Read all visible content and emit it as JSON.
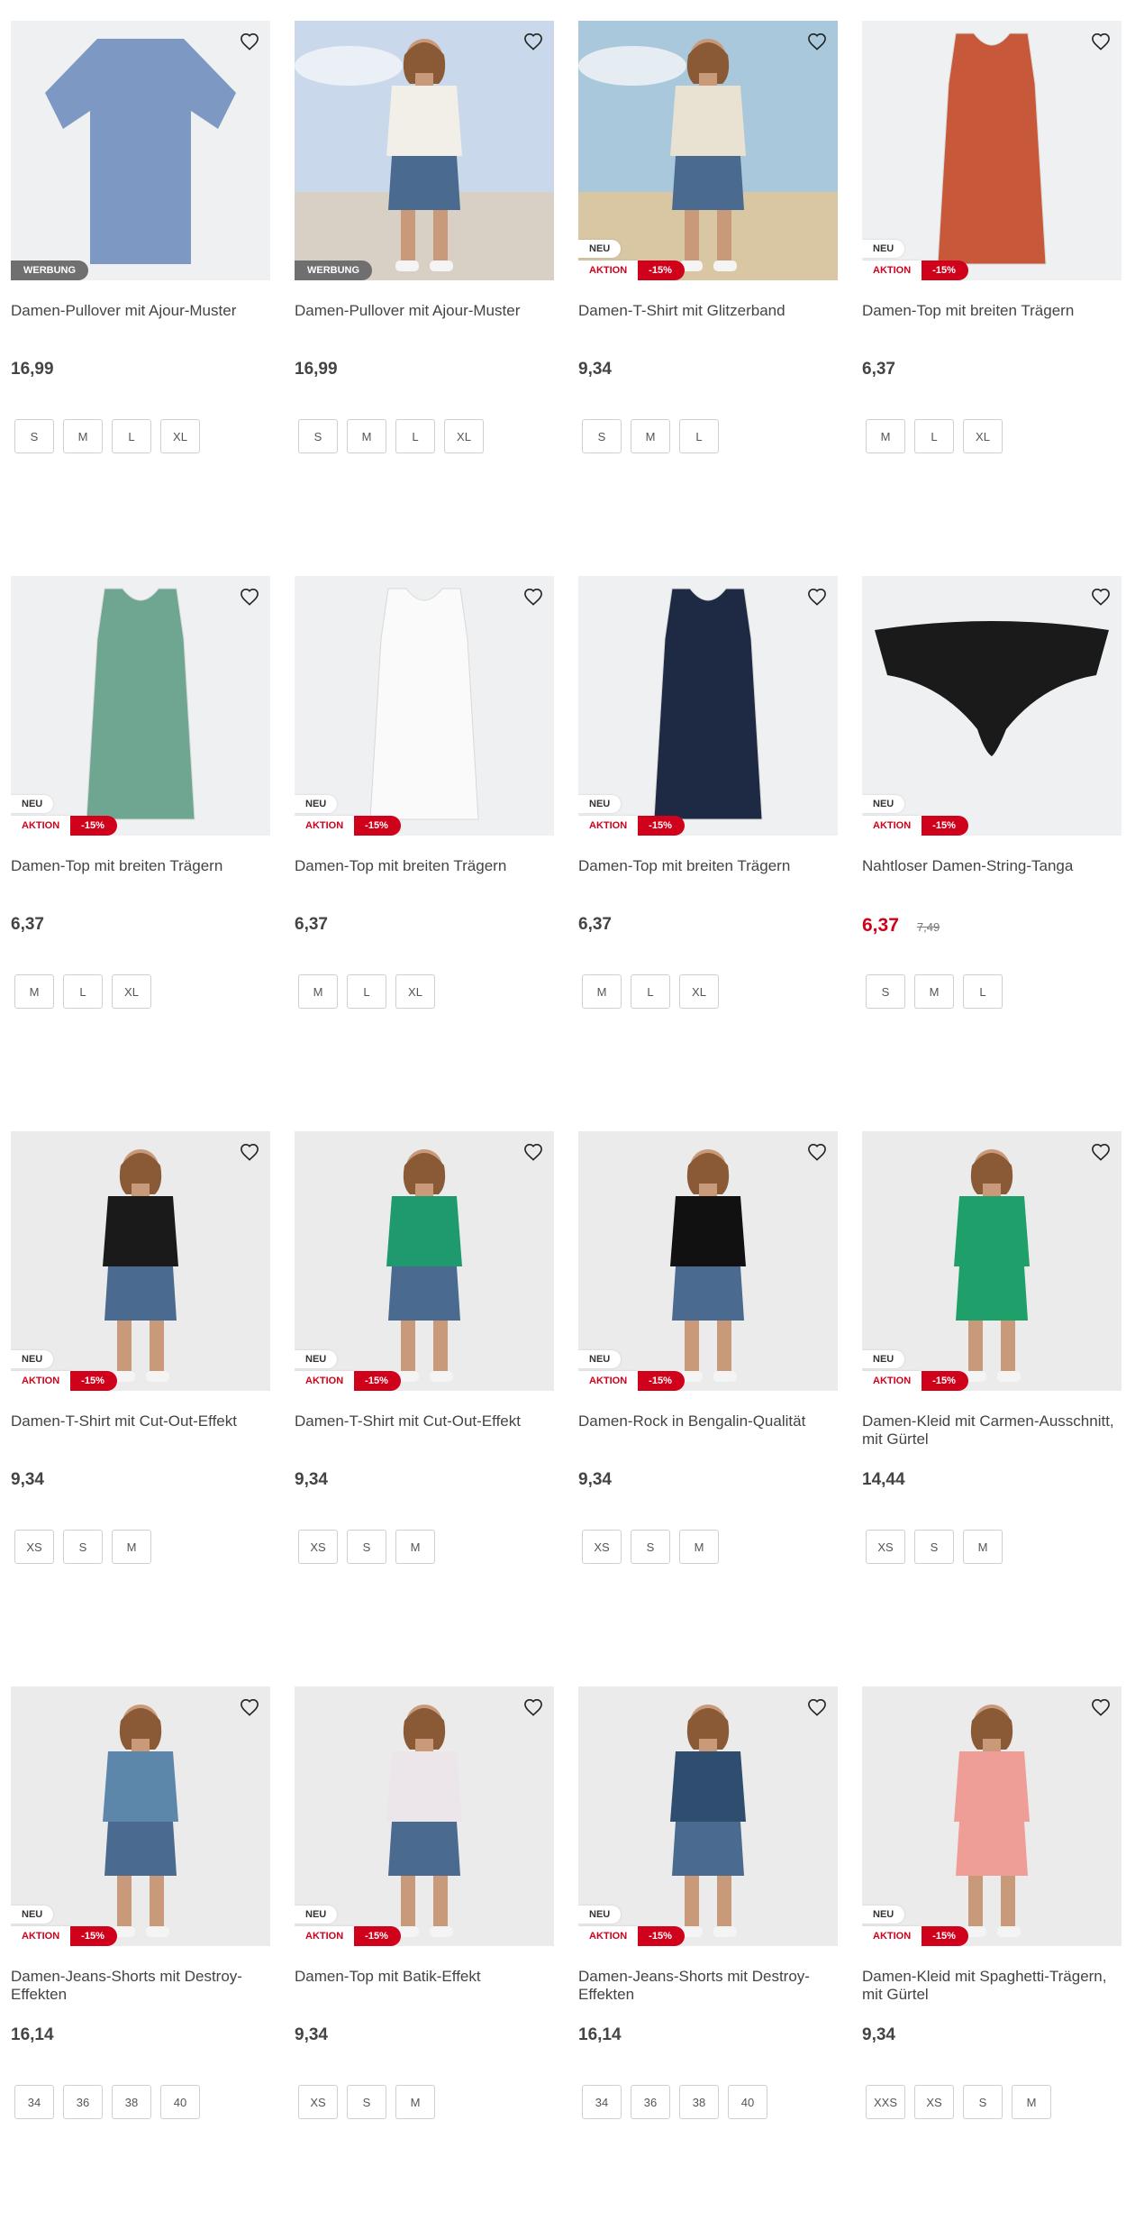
{
  "colors": {
    "accent": "#d0021b",
    "badge_grey": "#6f6f6f"
  },
  "products": [
    {
      "title": "Damen-Pullover mit Ajour-Muster",
      "price": "16,99",
      "old_price": "",
      "sale": false,
      "badges": [
        "WERBUNG"
      ],
      "sizes": [
        "S",
        "M",
        "L",
        "XL"
      ],
      "image": "blue-knit-pullover",
      "bg": "#eef0f1",
      "color": "#7d98c3"
    },
    {
      "title": "Damen-Pullover mit Ajour-Muster",
      "price": "16,99",
      "old_price": "",
      "sale": false,
      "badges": [
        "WERBUNG"
      ],
      "sizes": [
        "S",
        "M",
        "L",
        "XL"
      ],
      "image": "white-pullover-model-sky",
      "bg": "#c9d8ea",
      "color": "#f2efe8"
    },
    {
      "title": "Damen-T-Shirt mit Glitzerband",
      "price": "9,34",
      "old_price": "",
      "sale": false,
      "badges": [
        "NEU",
        "AKTION",
        "-15%"
      ],
      "sizes": [
        "S",
        "M",
        "L"
      ],
      "image": "beige-tshirt-model-beach",
      "bg": "#a9c8dc",
      "color": "#e9e1d2"
    },
    {
      "title": "Damen-Top mit breiten Trägern",
      "price": "6,37",
      "old_price": "",
      "sale": false,
      "badges": [
        "NEU",
        "AKTION",
        "-15%"
      ],
      "sizes": [
        "M",
        "L",
        "XL"
      ],
      "image": "orange-tank-top",
      "bg": "#eef0f1",
      "color": "#c8583a"
    },
    {
      "title": "Damen-Top mit breiten Trägern",
      "price": "6,37",
      "old_price": "",
      "sale": false,
      "badges": [
        "NEU",
        "AKTION",
        "-15%"
      ],
      "sizes": [
        "M",
        "L",
        "XL"
      ],
      "image": "green-tank-top",
      "bg": "#eef0f1",
      "color": "#6fa692"
    },
    {
      "title": "Damen-Top mit breiten Trägern",
      "price": "6,37",
      "old_price": "",
      "sale": false,
      "badges": [
        "NEU",
        "AKTION",
        "-15%"
      ],
      "sizes": [
        "M",
        "L",
        "XL"
      ],
      "image": "white-tank-top",
      "bg": "#eef0f1",
      "color": "#fafafa"
    },
    {
      "title": "Damen-Top mit breiten Trägern",
      "price": "6,37",
      "old_price": "",
      "sale": false,
      "badges": [
        "NEU",
        "AKTION",
        "-15%"
      ],
      "sizes": [
        "M",
        "L",
        "XL"
      ],
      "image": "navy-tank-top",
      "bg": "#eef0f1",
      "color": "#1e2a44"
    },
    {
      "title": "Nahtloser Damen-String-Tanga",
      "price": "6,37",
      "old_price": "7,49",
      "sale": true,
      "badges": [
        "NEU",
        "AKTION",
        "-15%"
      ],
      "sizes": [
        "S",
        "M",
        "L"
      ],
      "image": "black-thong",
      "bg": "#eef0f1",
      "color": "#1a1a1a"
    },
    {
      "title": "Damen-T-Shirt mit Cut-Out-Effekt",
      "price": "9,34",
      "old_price": "",
      "sale": false,
      "badges": [
        "NEU",
        "AKTION",
        "-15%"
      ],
      "sizes": [
        "XS",
        "S",
        "M"
      ],
      "image": "black-cutout-tshirt-model",
      "bg": "#ebebeb",
      "color": "#1a1a1a"
    },
    {
      "title": "Damen-T-Shirt mit Cut-Out-Effekt",
      "price": "9,34",
      "old_price": "",
      "sale": false,
      "badges": [
        "NEU",
        "AKTION",
        "-15%"
      ],
      "sizes": [
        "XS",
        "S",
        "M"
      ],
      "image": "green-cutout-tshirt-model",
      "bg": "#ebebeb",
      "color": "#1e9a6e"
    },
    {
      "title": "Damen-Rock in Bengalin-Qualität",
      "price": "9,34",
      "old_price": "",
      "sale": false,
      "badges": [
        "NEU",
        "AKTION",
        "-15%"
      ],
      "sizes": [
        "XS",
        "S",
        "M"
      ],
      "image": "black-skirt-model",
      "bg": "#ebebeb",
      "color": "#111111"
    },
    {
      "title": "Damen-Kleid mit Carmen-Ausschnitt, mit Gürtel",
      "price": "14,44",
      "old_price": "",
      "sale": false,
      "badges": [
        "NEU",
        "AKTION",
        "-15%"
      ],
      "sizes": [
        "XS",
        "S",
        "M"
      ],
      "image": "green-dress-model",
      "bg": "#ebebeb",
      "color": "#1fa06a"
    },
    {
      "title": "Damen-Jeans-Shorts mit Destroy-Effekten",
      "price": "16,14",
      "old_price": "",
      "sale": false,
      "badges": [
        "NEU",
        "AKTION",
        "-15%"
      ],
      "sizes": [
        "34",
        "36",
        "38",
        "40"
      ],
      "image": "striped-top-jeans-shorts-model",
      "bg": "#ebebeb",
      "color": "#5d86ab"
    },
    {
      "title": "Damen-Top mit Batik-Effekt",
      "price": "9,34",
      "old_price": "",
      "sale": false,
      "badges": [
        "NEU",
        "AKTION",
        "-15%"
      ],
      "sizes": [
        "XS",
        "S",
        "M"
      ],
      "image": "batik-top-model",
      "bg": "#ebebeb",
      "color": "#ece6ea"
    },
    {
      "title": "Damen-Jeans-Shorts mit Destroy-Effekten",
      "price": "16,14",
      "old_price": "",
      "sale": false,
      "badges": [
        "NEU",
        "AKTION",
        "-15%"
      ],
      "sizes": [
        "34",
        "36",
        "38",
        "40"
      ],
      "image": "pink-blouse-jeans-shorts-model",
      "bg": "#ebebeb",
      "color": "#2f4d6e"
    },
    {
      "title": "Damen-Kleid mit Spaghetti-Trägern, mit Gürtel",
      "price": "9,34",
      "old_price": "",
      "sale": false,
      "badges": [
        "NEU",
        "AKTION",
        "-15%"
      ],
      "sizes": [
        "XXS",
        "XS",
        "S",
        "M"
      ],
      "image": "floral-dress-model",
      "bg": "#ebebeb",
      "color": "#ef9d97"
    }
  ]
}
